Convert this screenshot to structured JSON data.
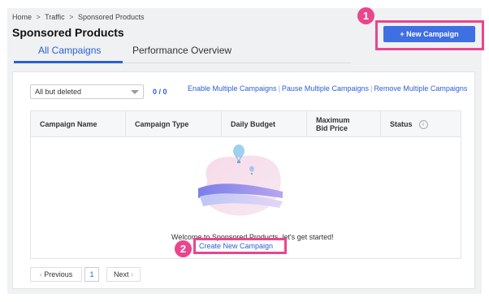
{
  "breadcrumb": {
    "home": "Home",
    "traffic": "Traffic",
    "current": "Sponsored Products",
    "separator": ">"
  },
  "page_title": "Sponsored Products",
  "tabs": [
    {
      "label": "All Campaigns",
      "active": true
    },
    {
      "label": "Performance Overview",
      "active": false
    }
  ],
  "header": {
    "new_campaign_label": "+ New Campaign"
  },
  "annotations": {
    "step1": "1",
    "step2": "2",
    "highlight_color": "#e9468d"
  },
  "filter": {
    "selected": "All but deleted",
    "count": "0 / 0"
  },
  "bulk_actions": {
    "enable": "Enable Multiple Campaigns",
    "pause": "Pause Multiple Campaigns",
    "remove": "Remove Multiple Campaigns",
    "divider": "|"
  },
  "table": {
    "columns": [
      "Campaign Name",
      "Campaign Type",
      "Daily Budget",
      "Maximum Bid Price",
      "Status"
    ],
    "rows": []
  },
  "empty_state": {
    "welcome": "Welcome to Sponsored Products, let's get started!",
    "create_link": "Create New Campaign"
  },
  "pagination": {
    "previous": "Previous",
    "page": "1",
    "next": "Next"
  },
  "colors": {
    "accent": "#3f6fe0",
    "link": "#2a5fd8",
    "highlight": "#e9468d"
  }
}
